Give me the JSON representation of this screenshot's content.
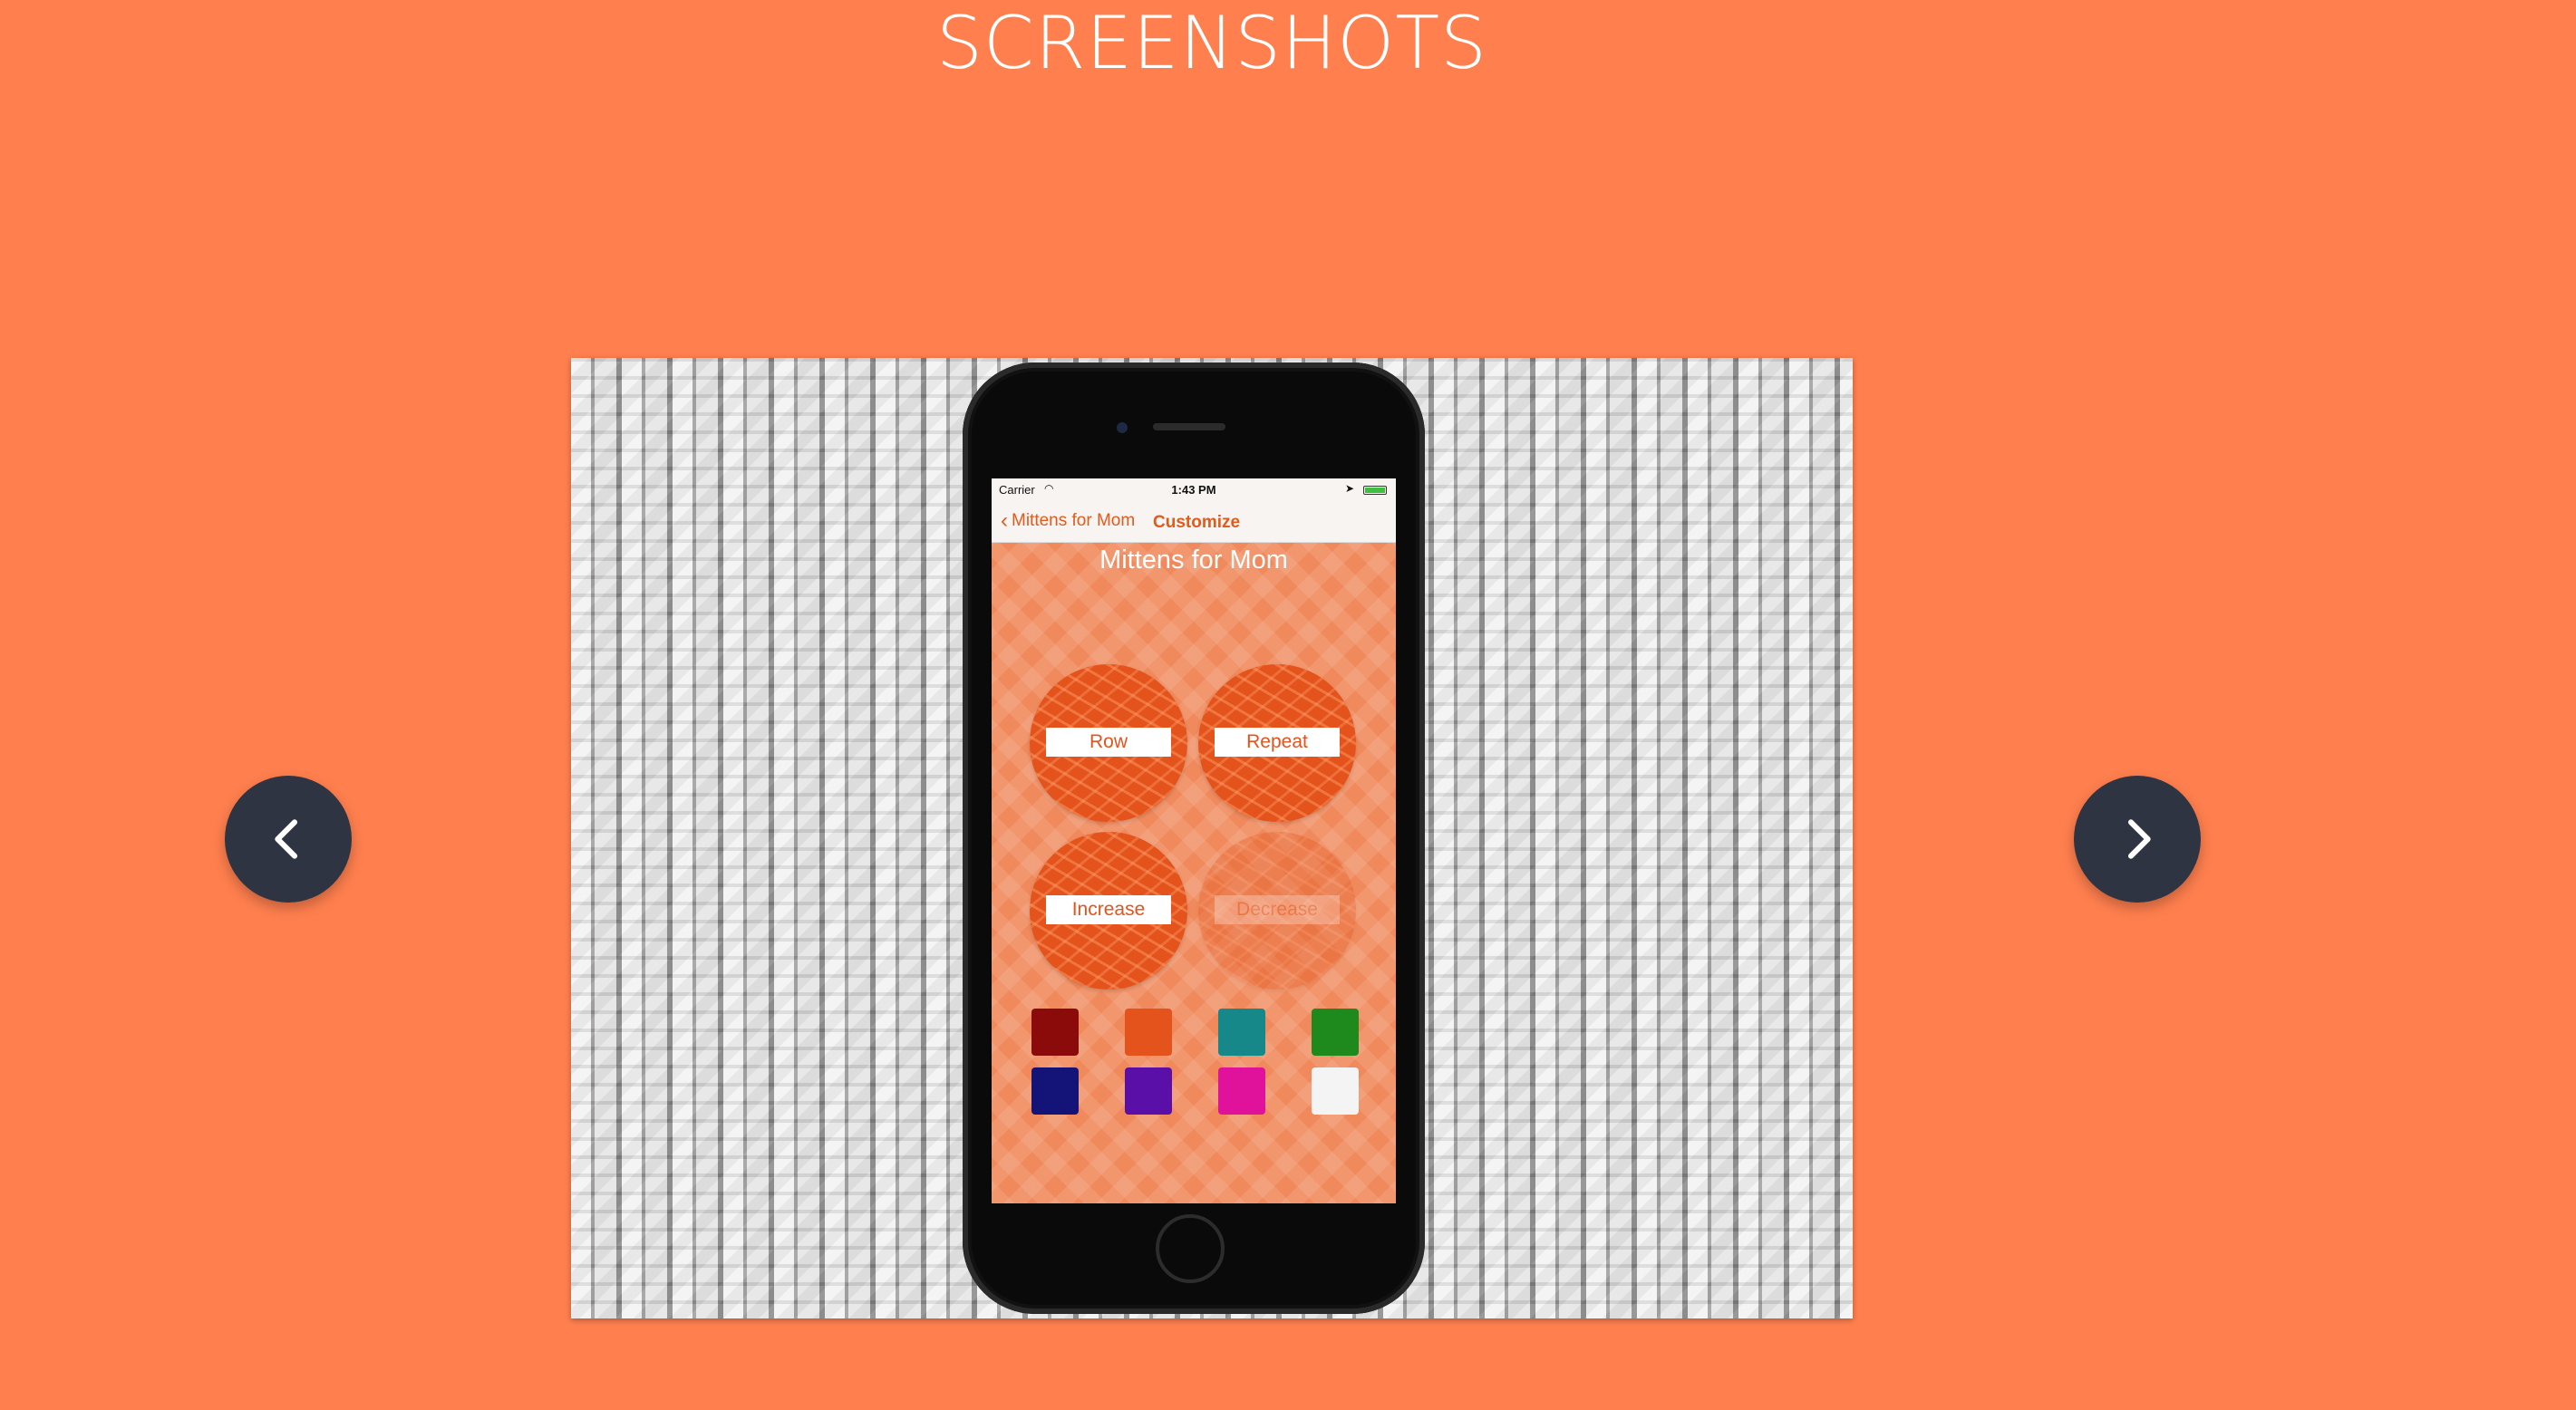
{
  "section": {
    "title": "SCREENSHOTS"
  },
  "carousel": {
    "prev_icon": "chevron-left-icon",
    "next_icon": "chevron-right-icon",
    "button_color": "#2E3441"
  },
  "app": {
    "status": {
      "carrier": "Carrier",
      "time": "1:43 PM"
    },
    "nav": {
      "back_label": "Mittens for Mom",
      "title": "Customize"
    },
    "screen_title": "Mittens for Mom",
    "counters": [
      {
        "label": "Row",
        "enabled": true
      },
      {
        "label": "Repeat",
        "enabled": true
      },
      {
        "label": "Increase",
        "enabled": true
      },
      {
        "label": "Decrease",
        "enabled": false
      }
    ],
    "swatches": [
      "#8B0A0A",
      "#E4531B",
      "#17888A",
      "#1E8A1E",
      "#141478",
      "#5A0FA8",
      "#E0119A",
      "#F4F4F4"
    ]
  },
  "colors": {
    "background": "#FF7F4E",
    "accent": "#E4531B"
  }
}
